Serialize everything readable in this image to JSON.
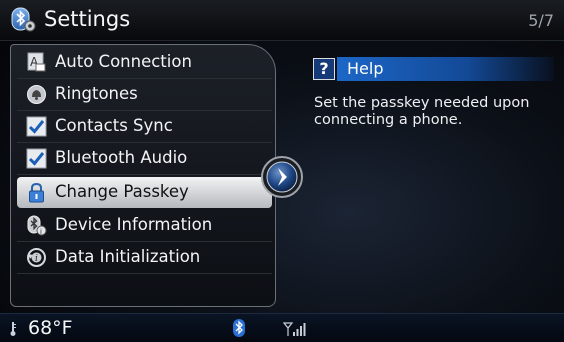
{
  "header": {
    "title": "Settings",
    "page_indicator": "5/7"
  },
  "menu": {
    "items": [
      {
        "label": "Auto Connection",
        "icon": "auto-connection-icon",
        "state": "normal"
      },
      {
        "label": "Ringtones",
        "icon": "ringtone-icon",
        "state": "normal"
      },
      {
        "label": "Contacts Sync",
        "icon": "checkbox-checked-icon",
        "state": "checked"
      },
      {
        "label": "Bluetooth Audio",
        "icon": "checkbox-checked-icon",
        "state": "checked"
      },
      {
        "label": "Change Passkey",
        "icon": "lock-icon",
        "state": "selected"
      },
      {
        "label": "Device Information",
        "icon": "bluetooth-info-icon",
        "state": "normal"
      },
      {
        "label": "Data Initialization",
        "icon": "initialize-icon",
        "state": "normal"
      }
    ]
  },
  "help": {
    "title": "Help",
    "text": "Set the passkey needed upon connecting a phone."
  },
  "status_bar": {
    "temperature": "68°F"
  },
  "colors": {
    "accent_blue": "#1c67c8",
    "selected_bg": "#e6e8ea",
    "background": "#05070a"
  }
}
